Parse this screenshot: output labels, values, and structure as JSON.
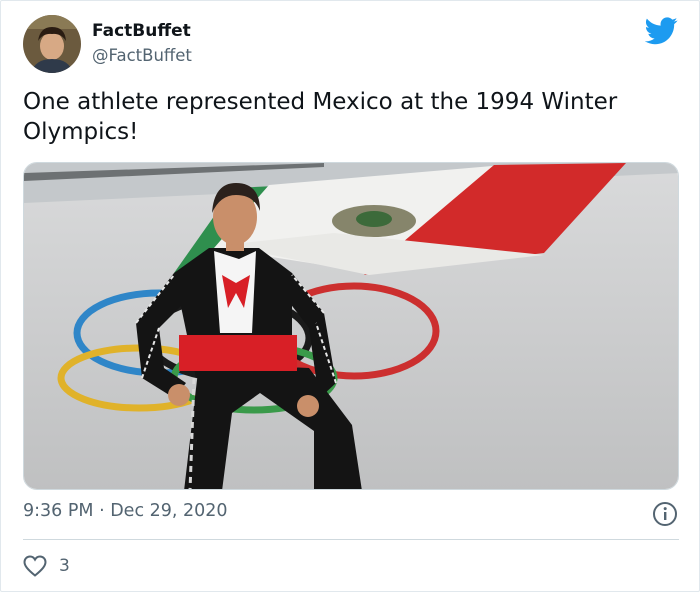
{
  "author": {
    "display_name": "FactBuffet",
    "handle": "@FactBuffet",
    "avatar_icon": "profile-photo",
    "platform_icon": "twitter-bird-icon"
  },
  "tweet": {
    "text": "One athlete represented Mexico at the 1994 Winter Olympics!"
  },
  "meta": {
    "timestamp": "9:36 PM · Dec 29, 2020"
  },
  "actions": {
    "like_count": "3"
  },
  "colors": {
    "twitter_blue": "#1d9bf0",
    "secondary_text": "#536471",
    "divider": "#cfd9de",
    "flag_green": "#2e8b57",
    "flag_red": "#ce1b2b"
  }
}
